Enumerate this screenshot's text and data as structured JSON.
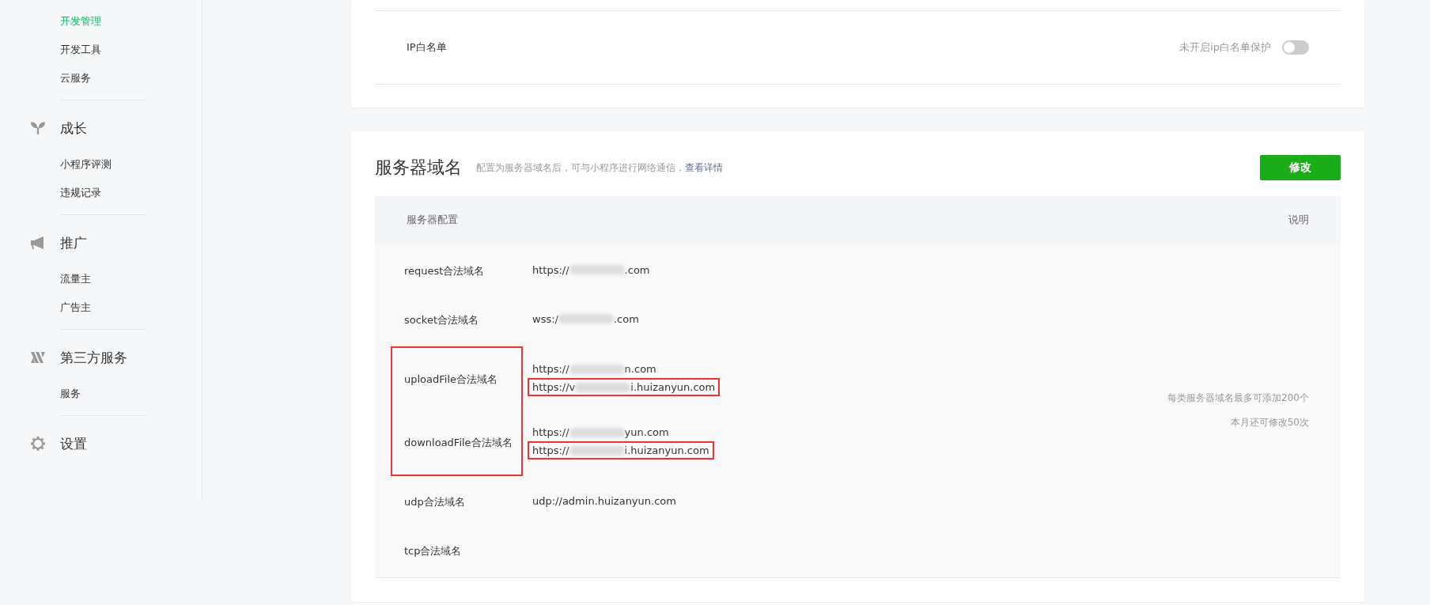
{
  "sidebar": {
    "groups": [
      {
        "items": [
          {
            "label": "开发管理",
            "selected": true
          },
          {
            "label": "开发工具",
            "selected": false
          },
          {
            "label": "云服务",
            "selected": false
          }
        ]
      },
      {
        "title": "成长",
        "items": [
          {
            "label": "小程序评测",
            "selected": false
          },
          {
            "label": "违规记录",
            "selected": false
          }
        ]
      },
      {
        "title": "推广",
        "items": [
          {
            "label": "流量主",
            "selected": false
          },
          {
            "label": "广告主",
            "selected": false
          }
        ]
      },
      {
        "title": "第三方服务",
        "items": [
          {
            "label": "服务",
            "selected": false
          }
        ]
      },
      {
        "title": "设置"
      }
    ]
  },
  "ip_whitelist": {
    "label": "IP白名单",
    "status": "未开启ip白名单保护",
    "on": false
  },
  "server_domains": {
    "title": "服务器域名",
    "description": "配置为服务器域名后，可与小程序进行网络通信，",
    "link": "查看详情",
    "button": "修改",
    "columns": [
      "服务器配置",
      "说明"
    ],
    "sections": [
      {
        "highlighted": false,
        "rows": [
          {
            "label": "request合法域名",
            "urls": [
              {
                "prefix": "https://",
                "suffix": ".com",
                "blurred": true,
                "highlighted": false
              }
            ]
          },
          {
            "label": "socket合法域名",
            "urls": [
              {
                "prefix": "wss:/",
                "suffix": ".com",
                "blurred": true,
                "highlighted": false
              }
            ]
          }
        ]
      },
      {
        "highlighted": true,
        "rows": [
          {
            "label": "uploadFile合法域名",
            "urls": [
              {
                "prefix": "https://",
                "suffix": "n.com",
                "blurred": true,
                "highlighted": false
              },
              {
                "prefix": "https://v",
                "suffix": "i.huizanyun.com",
                "blurred": true,
                "highlighted": true
              }
            ]
          },
          {
            "label": "downloadFile合法域名",
            "urls": [
              {
                "prefix": "https://",
                "suffix": "yun.com",
                "blurred": true,
                "highlighted": false
              },
              {
                "prefix": "https://",
                "suffix": "i.huizanyun.com",
                "blurred": true,
                "highlighted": true
              }
            ]
          }
        ]
      },
      {
        "highlighted": false,
        "rows": [
          {
            "label": "udp合法域名",
            "urls": [
              {
                "prefix": "udp://admin.huizanyun.com",
                "blurred": false,
                "highlighted": false
              }
            ]
          },
          {
            "label": "tcp合法域名"
          }
        ]
      }
    ],
    "notes": [
      "每类服务器域名最多可添加200个",
      "本月还可修改50次"
    ]
  }
}
